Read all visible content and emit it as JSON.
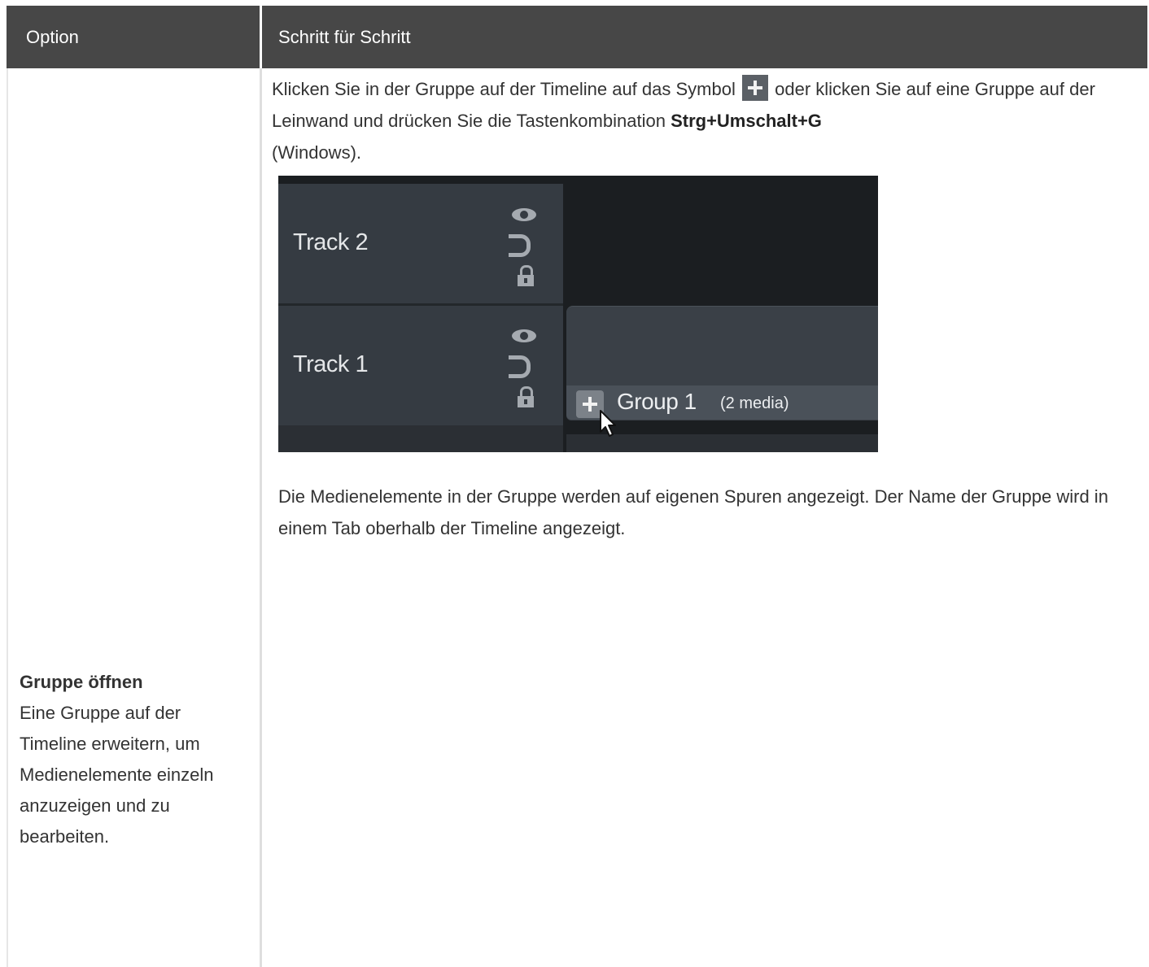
{
  "table": {
    "header": {
      "option": "Option",
      "steps": "Schritt für Schritt"
    },
    "row": {
      "option_title": "Gruppe öffnen",
      "option_description": "Eine Gruppe auf der Timeline erweitern, um Medienelemente einzeln anzuzeigen und zu bearbeiten.",
      "step_intro_1": "Klicken Sie in der Gruppe auf der Timeline auf das Symbol",
      "step_intro_2": "oder klicken Sie auf eine Gruppe auf der Leinwand und drücken Sie die Tastenkombination",
      "shortcut": "Strg+Umschalt+G",
      "step_intro_3": "(Windows).",
      "step_note": "Die Medienelemente in der Gruppe werden auf eigenen Spuren angezeigt. Der Name der Gruppe wird in einem Tab oberhalb der Timeline angezeigt."
    }
  },
  "timeline": {
    "tracks": [
      {
        "label": "Track 2"
      },
      {
        "label": "Track 1"
      }
    ],
    "group": {
      "name": "Group 1",
      "count": "(2 media)"
    },
    "icons": [
      "eye-icon",
      "magnet-icon",
      "lock-icon",
      "plus-icon",
      "cursor-icon"
    ]
  },
  "colors": {
    "header_bg": "#474747",
    "timeline_bg": "#1b1e21",
    "track_header_bg": "#353b42"
  }
}
